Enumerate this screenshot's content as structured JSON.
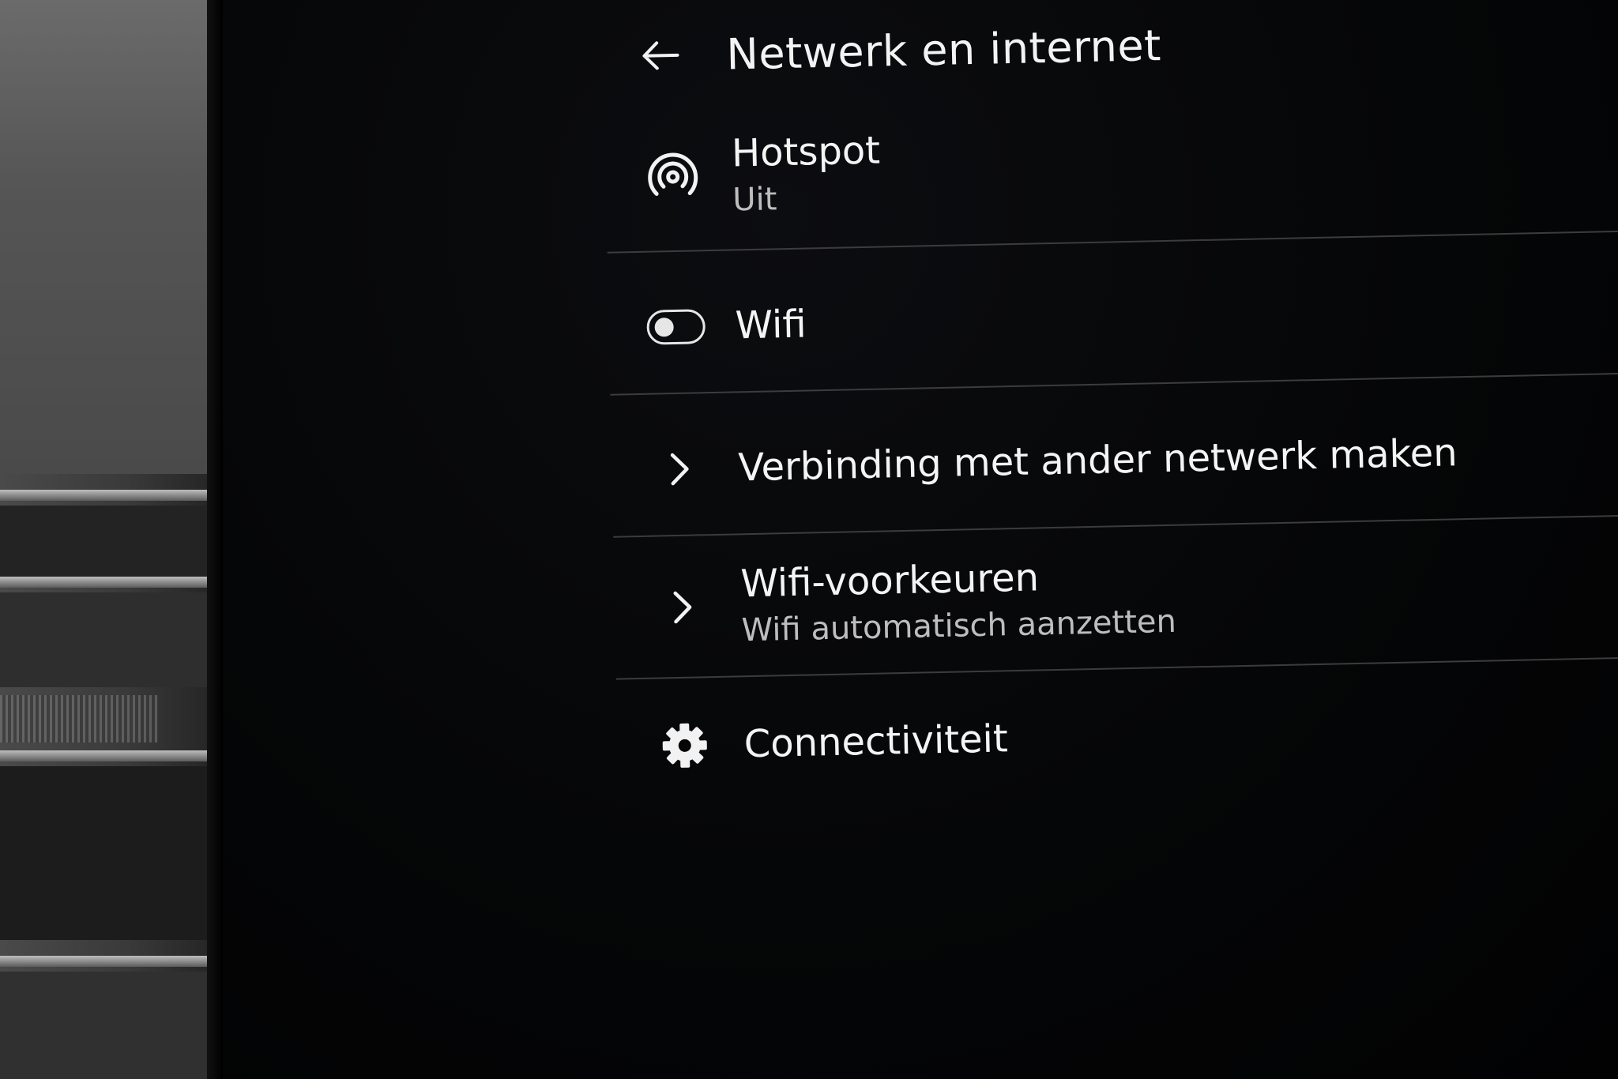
{
  "header": {
    "title": "Netwerk en internet",
    "back_icon": "arrow-left-icon"
  },
  "items": [
    {
      "id": "hotspot",
      "icon": "hotspot-icon",
      "label": "Hotspot",
      "subtitle": "Uit",
      "toggle_state": "off"
    },
    {
      "id": "wifi",
      "icon": "toggle-icon",
      "label": "Wifi",
      "toggle_state": "off"
    },
    {
      "id": "connect-other",
      "icon": "chevron-right-icon",
      "label": "Verbinding met ander netwerk maken"
    },
    {
      "id": "wifi-prefs",
      "icon": "chevron-right-icon",
      "label": "Wifi-voorkeuren",
      "subtitle": "Wifi automatisch aanzetten"
    },
    {
      "id": "connectivity",
      "icon": "gear-icon",
      "label": "Connectiviteit"
    }
  ],
  "colors": {
    "background": "#000000",
    "text_primary": "#f4f4f4",
    "text_secondary": "#bdbdbd",
    "divider": "#3c3c3e"
  }
}
